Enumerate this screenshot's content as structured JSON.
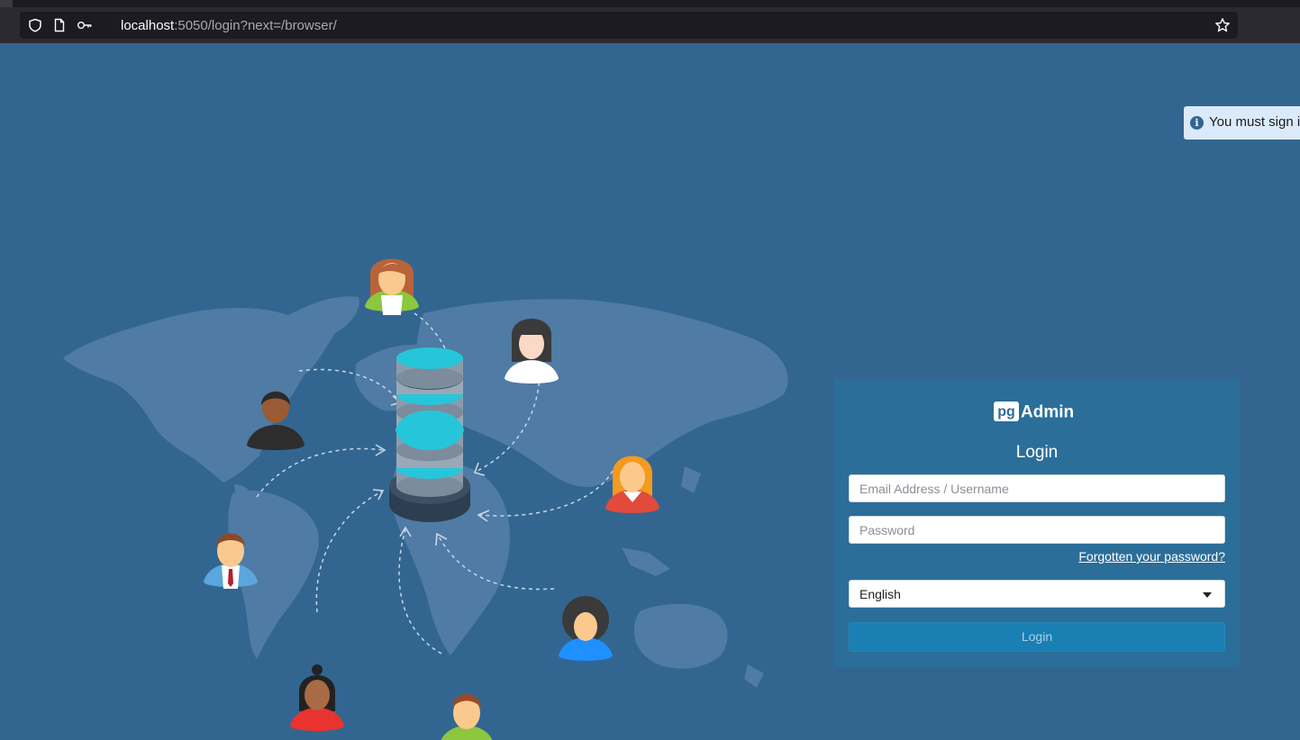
{
  "browser": {
    "url_host": "localhost",
    "url_rest": ":5050/login?next=/browser/"
  },
  "notification": {
    "text": "You must sign in to access this page.",
    "icon": "info-icon"
  },
  "login": {
    "brand_prefix": "pg",
    "brand_name": "Admin",
    "title": "Login",
    "email_placeholder": "Email Address / Username",
    "password_placeholder": "Password",
    "forgot_link": "Forgotten your password?",
    "language": "English",
    "submit_label": "Login"
  },
  "colors": {
    "page_background": "#326690",
    "panel_background": "#2b6e99",
    "button_background": "#1a7fb3",
    "database_accent": "#26c6da"
  }
}
